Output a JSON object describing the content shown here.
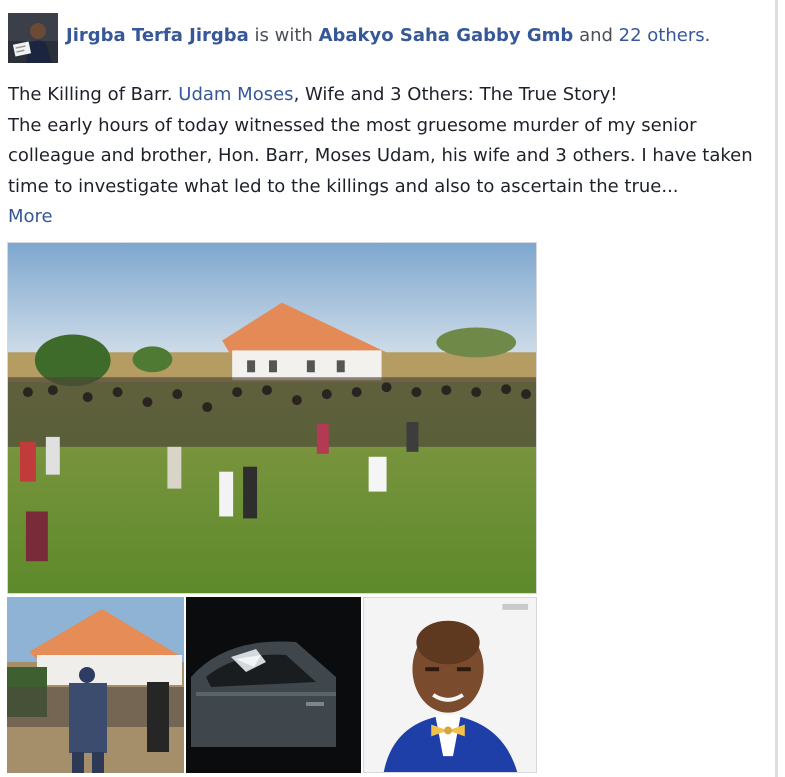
{
  "post": {
    "author": "Jirgba Terfa Jirgba",
    "is_with": "is with",
    "tagged": "Abakyo Saha Gabby Gmb",
    "and_word": "and",
    "others": "22 others",
    "period": ".",
    "line1_pre": "The Killing of Barr. ",
    "line1_tag": "Udam Moses",
    "line1_post": ", Wife and 3 Others: The True Story!",
    "body": "The early hours of today witnessed the most gruesome murder of my senior colleague and brother, Hon. Barr, Moses Udam, his wife and 3 others. I have taken time to investigate what led to the killings and also to ascertain the true...",
    "more": "More"
  },
  "photos": [
    {
      "name": "crowd-house-photo",
      "subject": "crowd gathered on grass field in front of orange-roofed house"
    },
    {
      "name": "police-house-photo",
      "subject": "police officer near orange-roofed house"
    },
    {
      "name": "car-photo",
      "subject": "dark car with smashed window at night"
    },
    {
      "name": "portrait-photo",
      "subject": "man in blue suit and yellow bow tie"
    }
  ],
  "colors": {
    "link": "#365899",
    "text": "#1d2129",
    "muted": "#4b4f56"
  }
}
